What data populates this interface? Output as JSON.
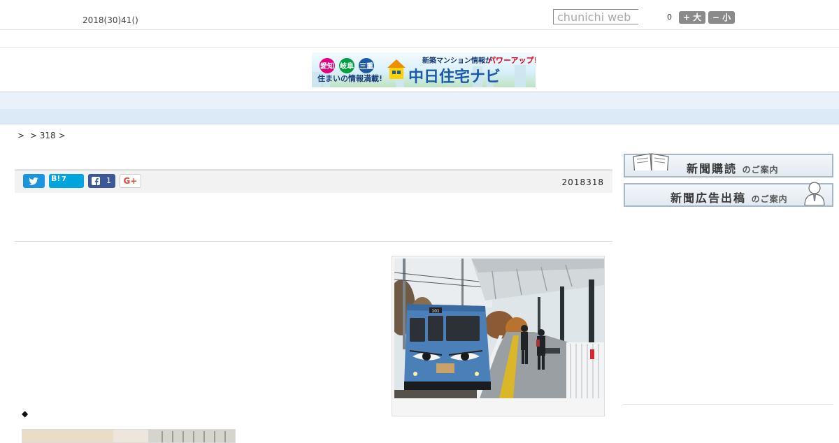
{
  "header": {
    "date_text": "2018(30)41()",
    "search_placeholder": "chunichi web",
    "font_size_value": "0",
    "font_larger_label": "+ 大",
    "font_smaller_label": "− 小"
  },
  "banner_ad": {
    "badges": [
      "愛知",
      "岐阜",
      "三重"
    ],
    "tagline": "住まいの情報満載!",
    "headline_small": "新築マンション情報が",
    "headline_accent": "パワーアップ!!",
    "brand": "中日住宅ナビ",
    "colors": {
      "accent": "#e60012",
      "brand_blue": "#1a5aa8"
    }
  },
  "nav": {
    "items": [
      "",
      "",
      "",
      "",
      "",
      "",
      "",
      "",
      ""
    ]
  },
  "breadcrumb": [
    ">",
    "> 318 >"
  ],
  "article": {
    "date": "2018318",
    "share": {
      "twitter_icon": "twitter-icon",
      "hatena_label": "B!",
      "hatena_count": "7",
      "facebook_count": "1",
      "gplus_label": "G+"
    },
    "bullet": "◆"
  },
  "sidebar": {
    "subscribe": {
      "main": "新聞購読",
      "sub": "のご案内"
    },
    "advertise": {
      "main": "新聞広告出稿",
      "sub": "のご案内"
    }
  },
  "colors": {
    "nav_bg": "#e9f1fa",
    "twitter": "#1b95e0",
    "hatena": "#00a4de",
    "facebook": "#3b5998",
    "train_blue": "#4a7fb8"
  }
}
